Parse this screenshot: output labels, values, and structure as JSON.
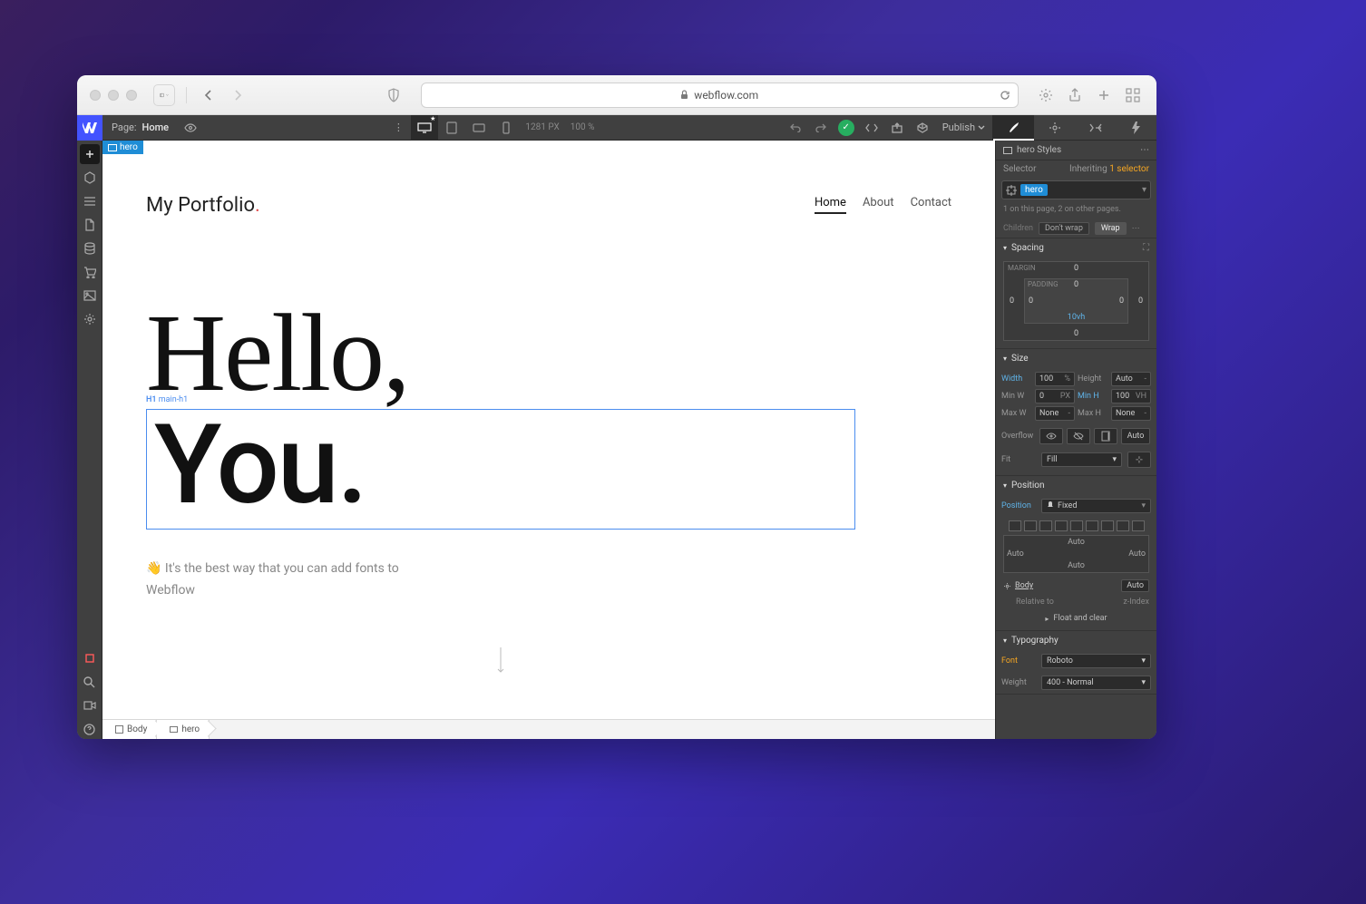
{
  "browser": {
    "url_host": "webflow.com"
  },
  "topbar": {
    "page_prefix": "Page:",
    "page_name": "Home",
    "viewport_width": "1281",
    "viewport_unit": "PX",
    "zoom": "100",
    "zoom_unit": "%",
    "publish": "Publish"
  },
  "page": {
    "brand_text": "My Portfolio",
    "brand_dot": ".",
    "nav": [
      "Home",
      "About",
      "Contact"
    ],
    "nav_active_index": 0,
    "h1_line1": "Hello,",
    "h1_line2": "You",
    "h1_dot": ".",
    "h1_tag": "H1",
    "h1_class": "main-h1",
    "tagline_l1": "👋 It's the best way that you can add fonts to",
    "tagline_l2": "Webflow",
    "selected_tag": "hero"
  },
  "breadcrumbs": [
    "Body",
    "hero"
  ],
  "inspector": {
    "header": "hero Styles",
    "selector_label": "Selector",
    "inheriting": "Inheriting",
    "inheriting_count": "1 selector",
    "class_name": "hero",
    "on_page": "1 on this page, 2 on other pages.",
    "children_label": "Children",
    "wrap_opts": [
      "Don't wrap",
      "Wrap"
    ],
    "sections": {
      "spacing": "Spacing",
      "size": "Size",
      "position": "Position",
      "typography": "Typography"
    },
    "spacing": {
      "margin_label": "MARGIN",
      "padding_label": "PADDING",
      "m_top": "0",
      "m_right": "0",
      "m_bottom": "0",
      "m_left": "0",
      "p_top": "0",
      "p_right": "0",
      "p_left": "0",
      "p_bottom": "10vh"
    },
    "size": {
      "width_label": "Width",
      "width_val": "100",
      "width_unit": "%",
      "height_label": "Height",
      "height_val": "Auto",
      "height_unit": "-",
      "minw_label": "Min W",
      "minw_val": "0",
      "minw_unit": "PX",
      "minh_label": "Min H",
      "minh_val": "100",
      "minh_unit": "VH",
      "maxw_label": "Max W",
      "maxw_val": "None",
      "maxw_unit": "-",
      "maxh_label": "Max H",
      "maxh_val": "None",
      "maxh_unit": "-",
      "overflow_label": "Overflow",
      "overflow_auto": "Auto",
      "fit_label": "Fit",
      "fit_val": "Fill"
    },
    "position": {
      "label": "Position",
      "value": "Fixed",
      "inset_top": "Auto",
      "inset_right": "Auto",
      "inset_bottom": "Auto",
      "inset_left": "Auto",
      "relative_to": "Relative to",
      "body": "Body",
      "zindex": "z-Index",
      "auto": "Auto",
      "float": "Float and clear"
    },
    "typography": {
      "font_label": "Font",
      "font_val": "Roboto",
      "weight_label": "Weight",
      "weight_val": "400 - Normal"
    }
  }
}
